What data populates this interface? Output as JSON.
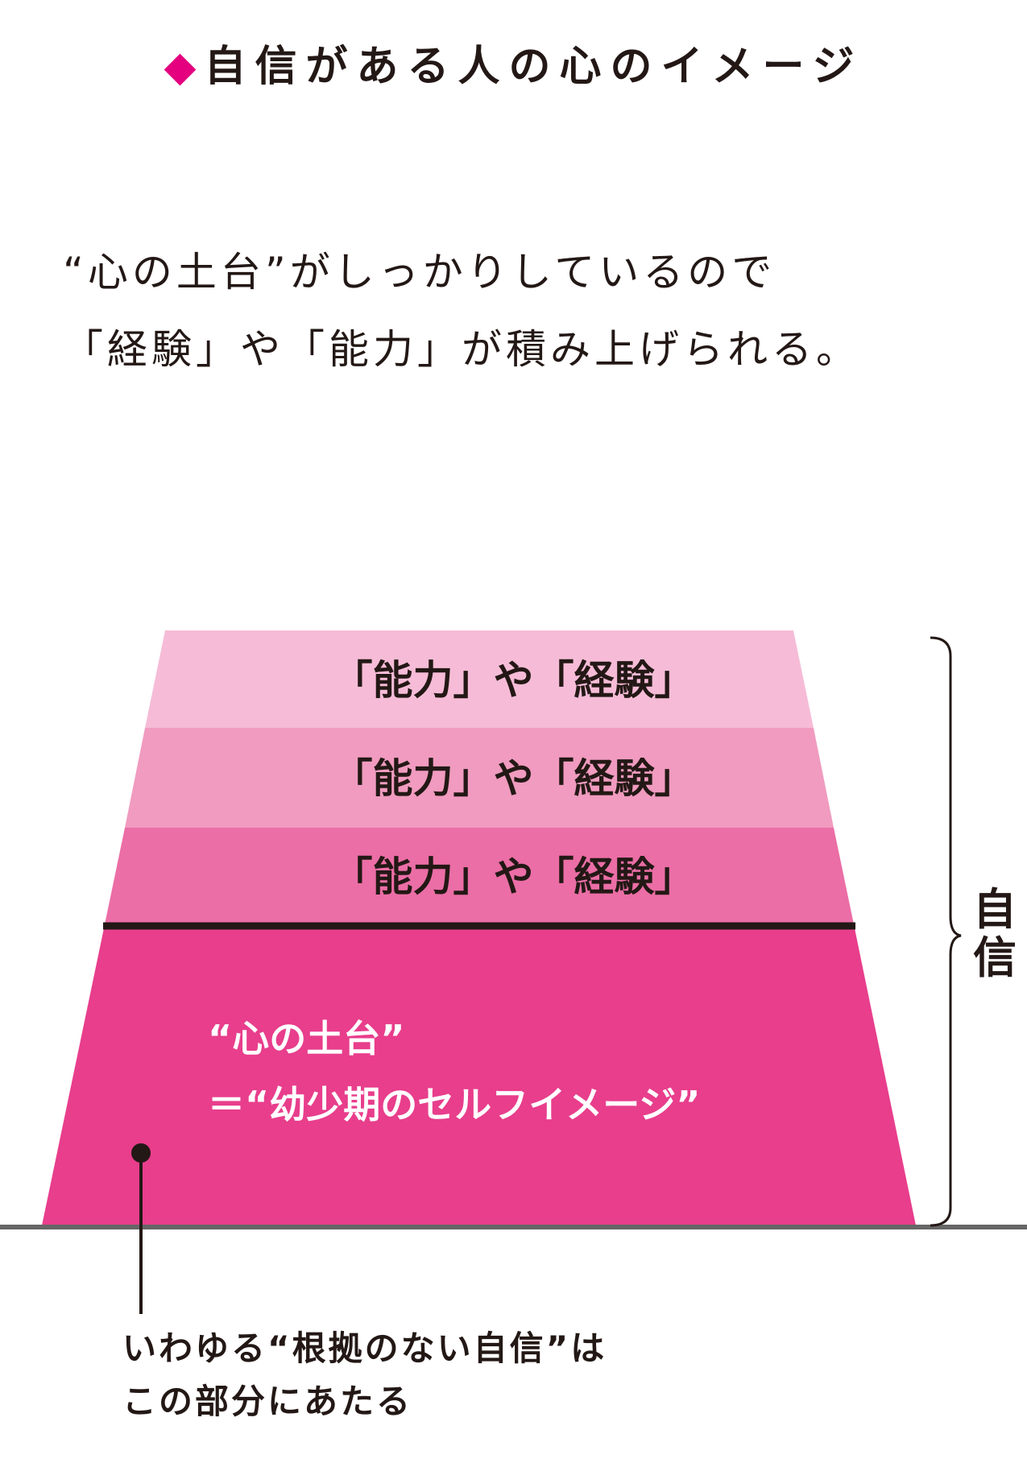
{
  "title": {
    "marker": "◆",
    "text": "自信がある人の心のイメージ"
  },
  "intro": {
    "line1": "“心の土台”がしっかりしているので",
    "line2": "「経験」や「能力」が積み上げられる。"
  },
  "diagram": {
    "layers": [
      {
        "label": "「能力」や「経験」",
        "color": "#f6bcd7"
      },
      {
        "label": "「能力」や「経験」",
        "color": "#f09bbf"
      },
      {
        "label": "「能力」や「経験」",
        "color": "#eb6ea6"
      }
    ],
    "foundation": {
      "line1": "“心の土台”",
      "line2": "＝“幼少期のセルフイメージ”",
      "color": "#e83e8c"
    },
    "brace_label": "自信",
    "note": {
      "line1": "いわゆる“根拠のない自信”は",
      "line2": "この部分にあたる"
    }
  },
  "colors": {
    "accent": "#e4007f",
    "text": "#231815",
    "ground": "#666666"
  }
}
